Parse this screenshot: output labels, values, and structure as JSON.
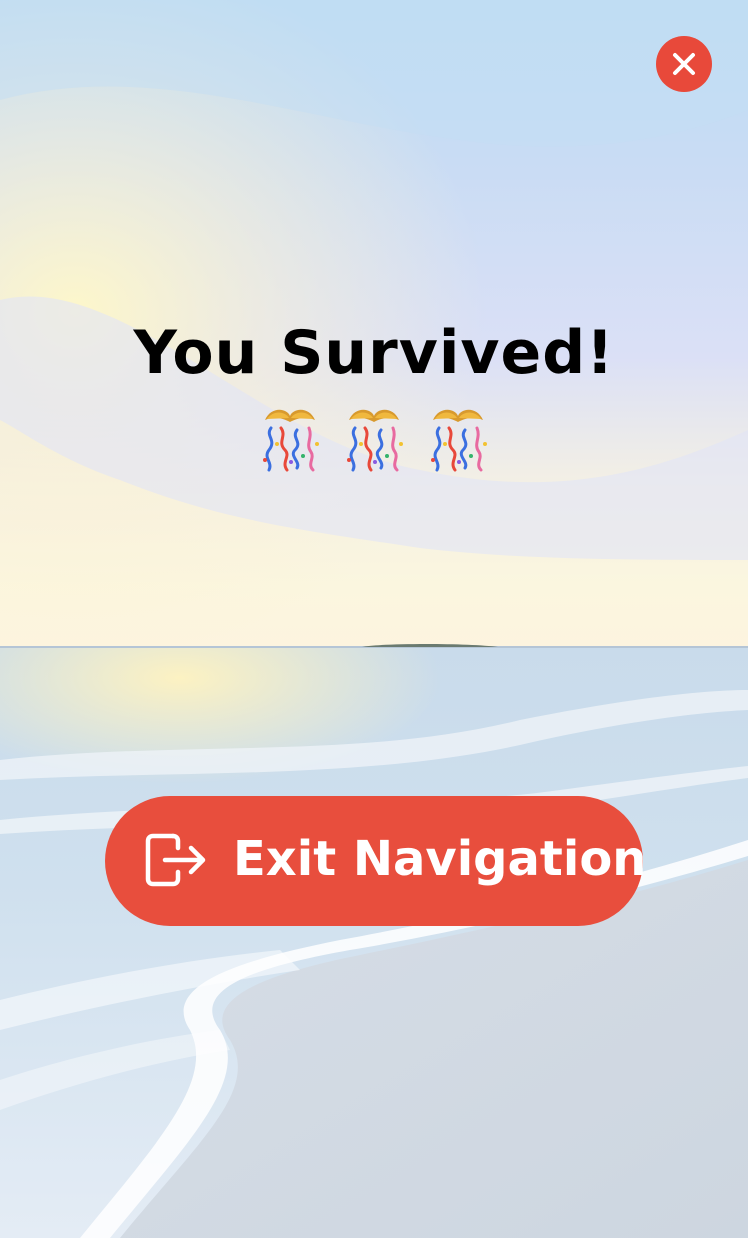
{
  "screen": {
    "title": "You Survived!",
    "celebration_emoji_icons": [
      "party-popper-icon",
      "party-popper-icon",
      "party-popper-icon"
    ]
  },
  "close_button": {
    "icon": "close-icon",
    "color": "#e8493a"
  },
  "exit_button": {
    "label": "Exit Navigation",
    "icon": "exit-icon",
    "color": "#e84e3d"
  }
}
